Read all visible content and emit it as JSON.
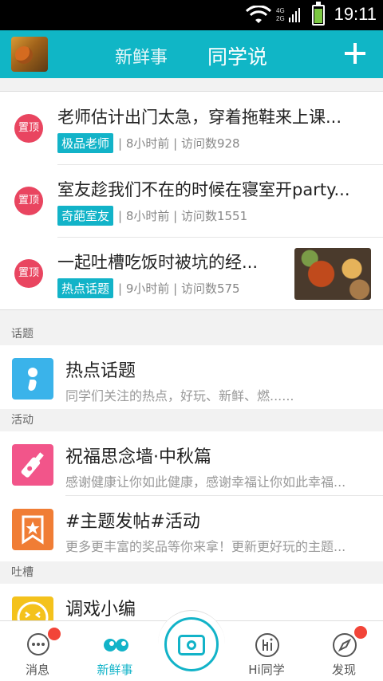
{
  "status_bar": {
    "time": "19:11",
    "network": "4G",
    "network2": "2G"
  },
  "header": {
    "tab_fresh": "新鲜事",
    "tab_classmates": "同学说"
  },
  "pinned": {
    "badge": "置顶",
    "items": [
      {
        "title": "老师估计出门太急，穿着拖鞋来上课...",
        "tag": "极品老师",
        "meta": "| 8小时前 | 访问数928"
      },
      {
        "title": "室友趁我们不在的时候在寝室开party...",
        "tag": "奇葩室友",
        "meta": "| 8小时前 | 访问数1551"
      },
      {
        "title": "一起吐槽吃饭时被坑的经...",
        "tag": "热点话题",
        "meta": "| 9小时前 | 访问数575"
      }
    ]
  },
  "sections": {
    "topics_label": "话题",
    "activities_label": "活动",
    "rants_label": "吐槽"
  },
  "features": {
    "hot": {
      "title": "热点话题",
      "desc": "同学们关注的热点，好玩、新鲜、燃......"
    },
    "wish": {
      "title": "祝福思念墙·中秋篇",
      "desc": "感谢健康让你如此健康，感谢幸福让你如此幸福..."
    },
    "theme": {
      "title": "#主题发帖#活动",
      "desc": "更多更丰富的奖品等你来拿！更新更好玩的主题..."
    },
    "joke": {
      "title": "调戏小编"
    }
  },
  "bottom_nav": {
    "messages": "消息",
    "fresh": "新鲜事",
    "hi_classmates": "Hi同学",
    "discover": "发现"
  },
  "colors": {
    "accent": "#10b6c6",
    "pin_badge": "#e94560",
    "notify_dot": "#f24438"
  }
}
